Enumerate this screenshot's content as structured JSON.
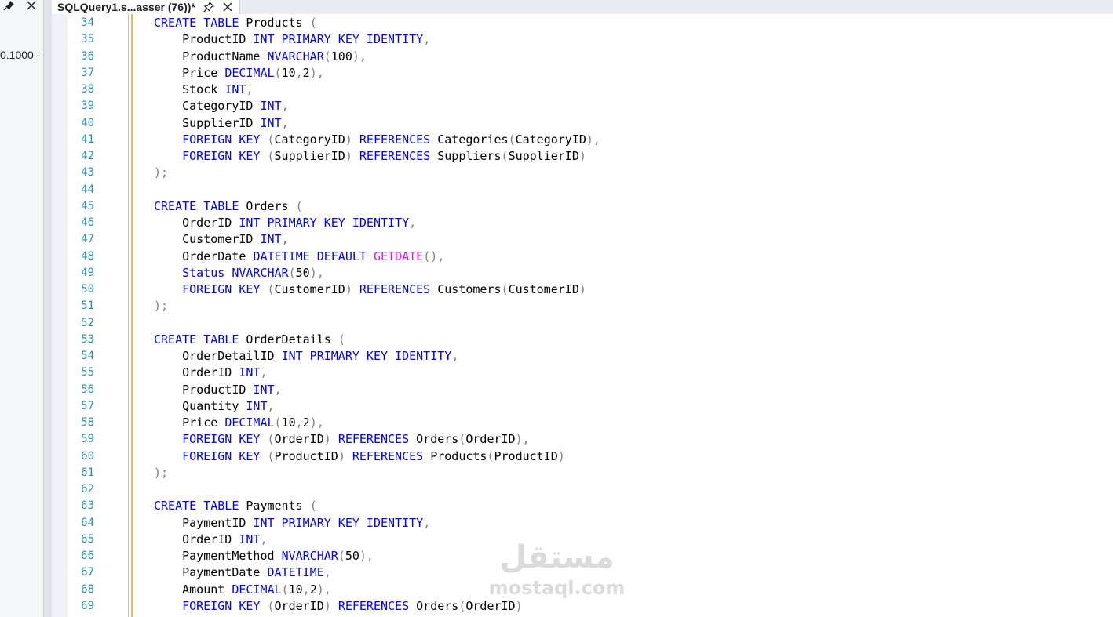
{
  "left_panel": {
    "fragment_text": "0.1000 -",
    "pin_icon": "pin-icon",
    "close_icon": "close-icon"
  },
  "tab": {
    "title": "SQLQuery1.s...asser (76))*",
    "pin_icon": "pin-icon",
    "close_icon": "close-icon"
  },
  "colors": {
    "keyword": "#0000ff",
    "function": "#ff00ff",
    "punctuation": "#808080",
    "line_number": "#2b91af",
    "change_marker": "#e0c245"
  },
  "editor": {
    "lines": [
      {
        "n": "34",
        "tokens": [
          [
            "kw",
            "CREATE TABLE "
          ],
          [
            "tx",
            "Products "
          ],
          [
            "gr",
            "("
          ]
        ]
      },
      {
        "n": "35",
        "tokens": [
          [
            "tx",
            "    ProductID "
          ],
          [
            "kw",
            "INT PRIMARY KEY IDENTITY"
          ],
          [
            "gr",
            ","
          ]
        ]
      },
      {
        "n": "36",
        "tokens": [
          [
            "tx",
            "    ProductName "
          ],
          [
            "kw",
            "NVARCHAR"
          ],
          [
            "gr",
            "("
          ],
          [
            "tx",
            "100"
          ],
          [
            "gr",
            "),"
          ]
        ]
      },
      {
        "n": "37",
        "tokens": [
          [
            "tx",
            "    Price "
          ],
          [
            "kw",
            "DECIMAL"
          ],
          [
            "gr",
            "("
          ],
          [
            "tx",
            "10"
          ],
          [
            "gr",
            ","
          ],
          [
            "tx",
            "2"
          ],
          [
            "gr",
            "),"
          ]
        ]
      },
      {
        "n": "38",
        "tokens": [
          [
            "tx",
            "    Stock "
          ],
          [
            "kw",
            "INT"
          ],
          [
            "gr",
            ","
          ]
        ]
      },
      {
        "n": "39",
        "tokens": [
          [
            "tx",
            "    CategoryID "
          ],
          [
            "kw",
            "INT"
          ],
          [
            "gr",
            ","
          ]
        ]
      },
      {
        "n": "40",
        "tokens": [
          [
            "tx",
            "    SupplierID "
          ],
          [
            "kw",
            "INT"
          ],
          [
            "gr",
            ","
          ]
        ]
      },
      {
        "n": "41",
        "tokens": [
          [
            "kw",
            "    FOREIGN KEY "
          ],
          [
            "gr",
            "("
          ],
          [
            "tx",
            "CategoryID"
          ],
          [
            "gr",
            ") "
          ],
          [
            "kw",
            "REFERENCES "
          ],
          [
            "tx",
            "Categories"
          ],
          [
            "gr",
            "("
          ],
          [
            "tx",
            "CategoryID"
          ],
          [
            "gr",
            "),"
          ]
        ]
      },
      {
        "n": "42",
        "tokens": [
          [
            "kw",
            "    FOREIGN KEY "
          ],
          [
            "gr",
            "("
          ],
          [
            "tx",
            "SupplierID"
          ],
          [
            "gr",
            ") "
          ],
          [
            "kw",
            "REFERENCES "
          ],
          [
            "tx",
            "Suppliers"
          ],
          [
            "gr",
            "("
          ],
          [
            "tx",
            "SupplierID"
          ],
          [
            "gr",
            ")"
          ]
        ]
      },
      {
        "n": "43",
        "tokens": [
          [
            "gr",
            ");"
          ]
        ]
      },
      {
        "n": "44",
        "tokens": []
      },
      {
        "n": "45",
        "tokens": [
          [
            "kw",
            "CREATE TABLE "
          ],
          [
            "tx",
            "Orders "
          ],
          [
            "gr",
            "("
          ]
        ]
      },
      {
        "n": "46",
        "tokens": [
          [
            "tx",
            "    OrderID "
          ],
          [
            "kw",
            "INT PRIMARY KEY IDENTITY"
          ],
          [
            "gr",
            ","
          ]
        ]
      },
      {
        "n": "47",
        "tokens": [
          [
            "tx",
            "    CustomerID "
          ],
          [
            "kw",
            "INT"
          ],
          [
            "gr",
            ","
          ]
        ]
      },
      {
        "n": "48",
        "tokens": [
          [
            "tx",
            "    OrderDate "
          ],
          [
            "kw",
            "DATETIME DEFAULT "
          ],
          [
            "fn",
            "GETDATE"
          ],
          [
            "gr",
            "(),"
          ]
        ]
      },
      {
        "n": "49",
        "tokens": [
          [
            "kw",
            "    Status NVARCHAR"
          ],
          [
            "gr",
            "("
          ],
          [
            "tx",
            "50"
          ],
          [
            "gr",
            "),"
          ]
        ]
      },
      {
        "n": "50",
        "tokens": [
          [
            "kw",
            "    FOREIGN KEY "
          ],
          [
            "gr",
            "("
          ],
          [
            "tx",
            "CustomerID"
          ],
          [
            "gr",
            ") "
          ],
          [
            "kw",
            "REFERENCES "
          ],
          [
            "tx",
            "Customers"
          ],
          [
            "gr",
            "("
          ],
          [
            "tx",
            "CustomerID"
          ],
          [
            "gr",
            ")"
          ]
        ]
      },
      {
        "n": "51",
        "tokens": [
          [
            "gr",
            ");"
          ]
        ]
      },
      {
        "n": "52",
        "tokens": []
      },
      {
        "n": "53",
        "tokens": [
          [
            "kw",
            "CREATE TABLE "
          ],
          [
            "tx",
            "OrderDetails "
          ],
          [
            "gr",
            "("
          ]
        ]
      },
      {
        "n": "54",
        "tokens": [
          [
            "tx",
            "    OrderDetailID "
          ],
          [
            "kw",
            "INT PRIMARY KEY IDENTITY"
          ],
          [
            "gr",
            ","
          ]
        ]
      },
      {
        "n": "55",
        "tokens": [
          [
            "tx",
            "    OrderID "
          ],
          [
            "kw",
            "INT"
          ],
          [
            "gr",
            ","
          ]
        ]
      },
      {
        "n": "56",
        "tokens": [
          [
            "tx",
            "    ProductID "
          ],
          [
            "kw",
            "INT"
          ],
          [
            "gr",
            ","
          ]
        ]
      },
      {
        "n": "57",
        "tokens": [
          [
            "tx",
            "    Quantity "
          ],
          [
            "kw",
            "INT"
          ],
          [
            "gr",
            ","
          ]
        ]
      },
      {
        "n": "58",
        "tokens": [
          [
            "tx",
            "    Price "
          ],
          [
            "kw",
            "DECIMAL"
          ],
          [
            "gr",
            "("
          ],
          [
            "tx",
            "10"
          ],
          [
            "gr",
            ","
          ],
          [
            "tx",
            "2"
          ],
          [
            "gr",
            "),"
          ]
        ]
      },
      {
        "n": "59",
        "tokens": [
          [
            "kw",
            "    FOREIGN KEY "
          ],
          [
            "gr",
            "("
          ],
          [
            "tx",
            "OrderID"
          ],
          [
            "gr",
            ") "
          ],
          [
            "kw",
            "REFERENCES "
          ],
          [
            "tx",
            "Orders"
          ],
          [
            "gr",
            "("
          ],
          [
            "tx",
            "OrderID"
          ],
          [
            "gr",
            "),"
          ]
        ]
      },
      {
        "n": "60",
        "tokens": [
          [
            "kw",
            "    FOREIGN KEY "
          ],
          [
            "gr",
            "("
          ],
          [
            "tx",
            "ProductID"
          ],
          [
            "gr",
            ") "
          ],
          [
            "kw",
            "REFERENCES "
          ],
          [
            "tx",
            "Products"
          ],
          [
            "gr",
            "("
          ],
          [
            "tx",
            "ProductID"
          ],
          [
            "gr",
            ")"
          ]
        ]
      },
      {
        "n": "61",
        "tokens": [
          [
            "gr",
            ");"
          ]
        ]
      },
      {
        "n": "62",
        "tokens": []
      },
      {
        "n": "63",
        "tokens": [
          [
            "kw",
            "CREATE TABLE "
          ],
          [
            "tx",
            "Payments "
          ],
          [
            "gr",
            "("
          ]
        ]
      },
      {
        "n": "64",
        "tokens": [
          [
            "tx",
            "    PaymentID "
          ],
          [
            "kw",
            "INT PRIMARY KEY IDENTITY"
          ],
          [
            "gr",
            ","
          ]
        ]
      },
      {
        "n": "65",
        "tokens": [
          [
            "tx",
            "    OrderID "
          ],
          [
            "kw",
            "INT"
          ],
          [
            "gr",
            ","
          ]
        ]
      },
      {
        "n": "66",
        "tokens": [
          [
            "tx",
            "    PaymentMethod "
          ],
          [
            "kw",
            "NVARCHAR"
          ],
          [
            "gr",
            "("
          ],
          [
            "tx",
            "50"
          ],
          [
            "gr",
            "),"
          ]
        ]
      },
      {
        "n": "67",
        "tokens": [
          [
            "tx",
            "    PaymentDate "
          ],
          [
            "kw",
            "DATETIME"
          ],
          [
            "gr",
            ","
          ]
        ]
      },
      {
        "n": "68",
        "tokens": [
          [
            "tx",
            "    Amount "
          ],
          [
            "kw",
            "DECIMAL"
          ],
          [
            "gr",
            "("
          ],
          [
            "tx",
            "10"
          ],
          [
            "gr",
            ","
          ],
          [
            "tx",
            "2"
          ],
          [
            "gr",
            "),"
          ]
        ]
      },
      {
        "n": "69",
        "tokens": [
          [
            "kw",
            "    FOREIGN KEY "
          ],
          [
            "gr",
            "("
          ],
          [
            "tx",
            "OrderID"
          ],
          [
            "gr",
            ") "
          ],
          [
            "kw",
            "REFERENCES "
          ],
          [
            "tx",
            "Orders"
          ],
          [
            "gr",
            "("
          ],
          [
            "tx",
            "OrderID"
          ],
          [
            "gr",
            ")"
          ]
        ]
      }
    ]
  },
  "watermark": {
    "arabic": "مستقل",
    "latin": "mostaql.com"
  }
}
